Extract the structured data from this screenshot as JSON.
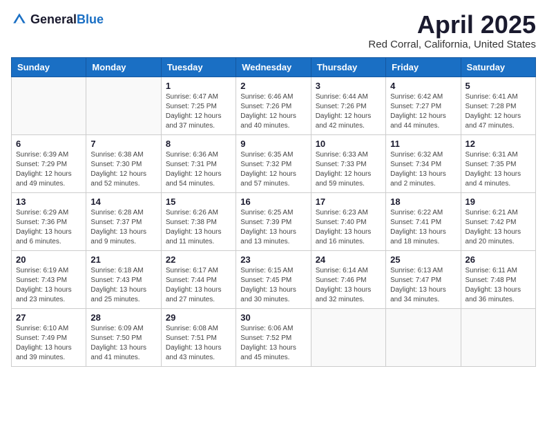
{
  "header": {
    "logo_general": "General",
    "logo_blue": "Blue",
    "month_title": "April 2025",
    "location": "Red Corral, California, United States"
  },
  "days_of_week": [
    "Sunday",
    "Monday",
    "Tuesday",
    "Wednesday",
    "Thursday",
    "Friday",
    "Saturday"
  ],
  "weeks": [
    [
      {
        "day": "",
        "sunrise": "",
        "sunset": "",
        "daylight": ""
      },
      {
        "day": "",
        "sunrise": "",
        "sunset": "",
        "daylight": ""
      },
      {
        "day": "1",
        "sunrise": "Sunrise: 6:47 AM",
        "sunset": "Sunset: 7:25 PM",
        "daylight": "Daylight: 12 hours and 37 minutes."
      },
      {
        "day": "2",
        "sunrise": "Sunrise: 6:46 AM",
        "sunset": "Sunset: 7:26 PM",
        "daylight": "Daylight: 12 hours and 40 minutes."
      },
      {
        "day": "3",
        "sunrise": "Sunrise: 6:44 AM",
        "sunset": "Sunset: 7:26 PM",
        "daylight": "Daylight: 12 hours and 42 minutes."
      },
      {
        "day": "4",
        "sunrise": "Sunrise: 6:42 AM",
        "sunset": "Sunset: 7:27 PM",
        "daylight": "Daylight: 12 hours and 44 minutes."
      },
      {
        "day": "5",
        "sunrise": "Sunrise: 6:41 AM",
        "sunset": "Sunset: 7:28 PM",
        "daylight": "Daylight: 12 hours and 47 minutes."
      }
    ],
    [
      {
        "day": "6",
        "sunrise": "Sunrise: 6:39 AM",
        "sunset": "Sunset: 7:29 PM",
        "daylight": "Daylight: 12 hours and 49 minutes."
      },
      {
        "day": "7",
        "sunrise": "Sunrise: 6:38 AM",
        "sunset": "Sunset: 7:30 PM",
        "daylight": "Daylight: 12 hours and 52 minutes."
      },
      {
        "day": "8",
        "sunrise": "Sunrise: 6:36 AM",
        "sunset": "Sunset: 7:31 PM",
        "daylight": "Daylight: 12 hours and 54 minutes."
      },
      {
        "day": "9",
        "sunrise": "Sunrise: 6:35 AM",
        "sunset": "Sunset: 7:32 PM",
        "daylight": "Daylight: 12 hours and 57 minutes."
      },
      {
        "day": "10",
        "sunrise": "Sunrise: 6:33 AM",
        "sunset": "Sunset: 7:33 PM",
        "daylight": "Daylight: 12 hours and 59 minutes."
      },
      {
        "day": "11",
        "sunrise": "Sunrise: 6:32 AM",
        "sunset": "Sunset: 7:34 PM",
        "daylight": "Daylight: 13 hours and 2 minutes."
      },
      {
        "day": "12",
        "sunrise": "Sunrise: 6:31 AM",
        "sunset": "Sunset: 7:35 PM",
        "daylight": "Daylight: 13 hours and 4 minutes."
      }
    ],
    [
      {
        "day": "13",
        "sunrise": "Sunrise: 6:29 AM",
        "sunset": "Sunset: 7:36 PM",
        "daylight": "Daylight: 13 hours and 6 minutes."
      },
      {
        "day": "14",
        "sunrise": "Sunrise: 6:28 AM",
        "sunset": "Sunset: 7:37 PM",
        "daylight": "Daylight: 13 hours and 9 minutes."
      },
      {
        "day": "15",
        "sunrise": "Sunrise: 6:26 AM",
        "sunset": "Sunset: 7:38 PM",
        "daylight": "Daylight: 13 hours and 11 minutes."
      },
      {
        "day": "16",
        "sunrise": "Sunrise: 6:25 AM",
        "sunset": "Sunset: 7:39 PM",
        "daylight": "Daylight: 13 hours and 13 minutes."
      },
      {
        "day": "17",
        "sunrise": "Sunrise: 6:23 AM",
        "sunset": "Sunset: 7:40 PM",
        "daylight": "Daylight: 13 hours and 16 minutes."
      },
      {
        "day": "18",
        "sunrise": "Sunrise: 6:22 AM",
        "sunset": "Sunset: 7:41 PM",
        "daylight": "Daylight: 13 hours and 18 minutes."
      },
      {
        "day": "19",
        "sunrise": "Sunrise: 6:21 AM",
        "sunset": "Sunset: 7:42 PM",
        "daylight": "Daylight: 13 hours and 20 minutes."
      }
    ],
    [
      {
        "day": "20",
        "sunrise": "Sunrise: 6:19 AM",
        "sunset": "Sunset: 7:43 PM",
        "daylight": "Daylight: 13 hours and 23 minutes."
      },
      {
        "day": "21",
        "sunrise": "Sunrise: 6:18 AM",
        "sunset": "Sunset: 7:43 PM",
        "daylight": "Daylight: 13 hours and 25 minutes."
      },
      {
        "day": "22",
        "sunrise": "Sunrise: 6:17 AM",
        "sunset": "Sunset: 7:44 PM",
        "daylight": "Daylight: 13 hours and 27 minutes."
      },
      {
        "day": "23",
        "sunrise": "Sunrise: 6:15 AM",
        "sunset": "Sunset: 7:45 PM",
        "daylight": "Daylight: 13 hours and 30 minutes."
      },
      {
        "day": "24",
        "sunrise": "Sunrise: 6:14 AM",
        "sunset": "Sunset: 7:46 PM",
        "daylight": "Daylight: 13 hours and 32 minutes."
      },
      {
        "day": "25",
        "sunrise": "Sunrise: 6:13 AM",
        "sunset": "Sunset: 7:47 PM",
        "daylight": "Daylight: 13 hours and 34 minutes."
      },
      {
        "day": "26",
        "sunrise": "Sunrise: 6:11 AM",
        "sunset": "Sunset: 7:48 PM",
        "daylight": "Daylight: 13 hours and 36 minutes."
      }
    ],
    [
      {
        "day": "27",
        "sunrise": "Sunrise: 6:10 AM",
        "sunset": "Sunset: 7:49 PM",
        "daylight": "Daylight: 13 hours and 39 minutes."
      },
      {
        "day": "28",
        "sunrise": "Sunrise: 6:09 AM",
        "sunset": "Sunset: 7:50 PM",
        "daylight": "Daylight: 13 hours and 41 minutes."
      },
      {
        "day": "29",
        "sunrise": "Sunrise: 6:08 AM",
        "sunset": "Sunset: 7:51 PM",
        "daylight": "Daylight: 13 hours and 43 minutes."
      },
      {
        "day": "30",
        "sunrise": "Sunrise: 6:06 AM",
        "sunset": "Sunset: 7:52 PM",
        "daylight": "Daylight: 13 hours and 45 minutes."
      },
      {
        "day": "",
        "sunrise": "",
        "sunset": "",
        "daylight": ""
      },
      {
        "day": "",
        "sunrise": "",
        "sunset": "",
        "daylight": ""
      },
      {
        "day": "",
        "sunrise": "",
        "sunset": "",
        "daylight": ""
      }
    ]
  ]
}
